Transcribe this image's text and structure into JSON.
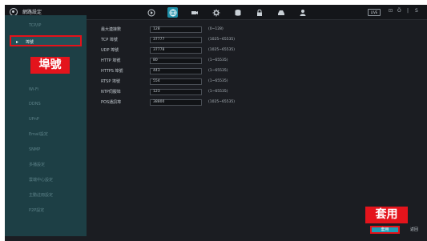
{
  "header": {
    "title": "網路設定",
    "icons": [
      "playback-icon",
      "network-icon",
      "camera-icon",
      "settings-icon",
      "storage-icon",
      "lock-icon",
      "device-icon",
      "user-icon"
    ],
    "live_label": "LIVE",
    "controls": [
      "⊡",
      "Ö",
      "|",
      "S"
    ]
  },
  "sidebar": {
    "items": [
      {
        "label": "TCP/IP"
      },
      {
        "label": "埠號"
      },
      {
        "label": "Wi-Fi"
      },
      {
        "label": "DDNS"
      },
      {
        "label": "UPnP"
      },
      {
        "label": "Email設定"
      },
      {
        "label": "SNMP"
      },
      {
        "label": "多播設定"
      },
      {
        "label": "雲端中心設定"
      },
      {
        "label": "主動註冊設定"
      },
      {
        "label": "P2P設定"
      }
    ]
  },
  "form": {
    "rows": [
      {
        "label": "最大連接數",
        "value": "128",
        "range": "(0~128)"
      },
      {
        "label": "TCP 埠號",
        "value": "37777",
        "range": "(1025~65535)"
      },
      {
        "label": "UDP 埠號",
        "value": "37778",
        "range": "(1025~65535)"
      },
      {
        "label": "HTTP 埠號",
        "value": "80",
        "range": "(1~65535)"
      },
      {
        "label": "HTTPS 埠號",
        "value": "443",
        "range": "(1~65535)"
      },
      {
        "label": "RTSP 埠號",
        "value": "554",
        "range": "(1~65535)"
      },
      {
        "label": "NTP伺服埠",
        "value": "123",
        "range": "(1~65535)"
      },
      {
        "label": "POS通訊埠",
        "value": "38800",
        "range": "(1025~65535)"
      }
    ]
  },
  "callouts": {
    "port": "埠號",
    "apply": "套用"
  },
  "footer": {
    "apply_label": "套用",
    "back_label": "返回"
  },
  "colors": {
    "accent": "#1ba0b8",
    "highlight": "#e4121a",
    "sidebar_bg": "#1d3f45"
  }
}
